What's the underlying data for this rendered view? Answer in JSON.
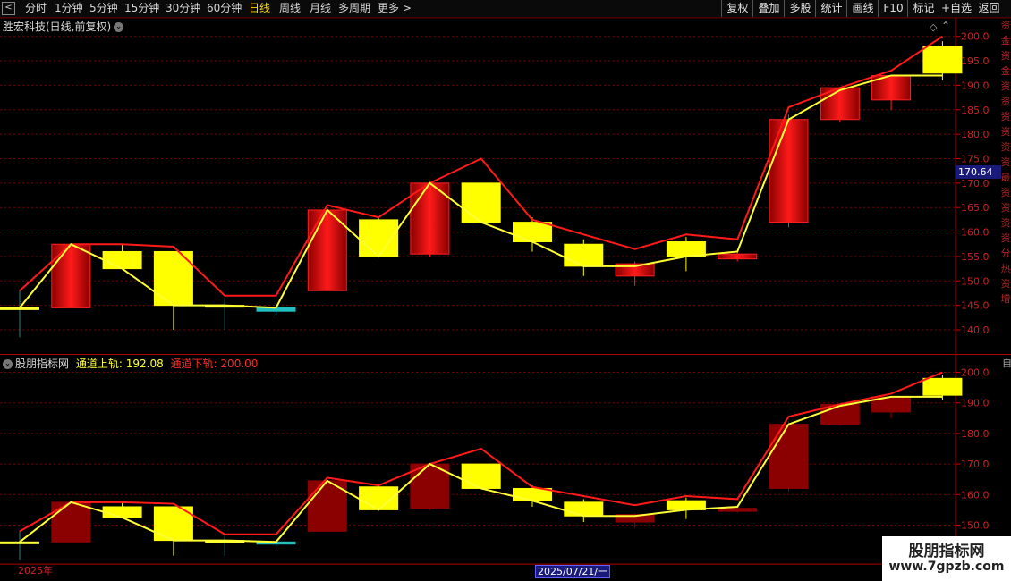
{
  "toolbar": {
    "left_items": [
      {
        "label": "分时",
        "active": false
      },
      {
        "label": "1分钟",
        "active": false
      },
      {
        "label": "5分钟",
        "active": false
      },
      {
        "label": "15分钟",
        "active": false
      },
      {
        "label": "30分钟",
        "active": false
      },
      {
        "label": "60分钟",
        "active": false
      },
      {
        "label": "日线",
        "active": true
      },
      {
        "label": "周线",
        "active": false
      },
      {
        "label": "月线",
        "active": false
      },
      {
        "label": "多周期",
        "active": false
      },
      {
        "label": "更多",
        "active": false
      }
    ],
    "right_items": [
      "复权",
      "叠加",
      "多股",
      "统计",
      "画线",
      "F10",
      "标记",
      "+自选",
      "返回"
    ],
    "more_arrow": ">"
  },
  "main_panel": {
    "title": "胜宏科技(日线,前复权)",
    "price_tag": "170.64",
    "edge_text": [
      "资",
      "金",
      "资",
      "金",
      "资",
      "资",
      "资",
      "资",
      "资",
      "资",
      "最",
      "资",
      "资",
      "资",
      "资",
      "分",
      "热",
      "资",
      "增"
    ],
    "y_ticks": [
      "200.0",
      "195.0",
      "190.0",
      "185.0",
      "180.0",
      "175.0",
      "170.0",
      "165.0",
      "160.0",
      "155.0",
      "150.0",
      "145.0",
      "140.0"
    ]
  },
  "indicator_panel": {
    "title": "股朋指标网",
    "upper_label": "通道上轨:",
    "upper_value": "192.08",
    "lower_label": "通道下轨:",
    "lower_value": "200.00",
    "edge_text": "自",
    "y_ticks": [
      "200.0",
      "190.0",
      "180.0",
      "170.0",
      "160.0",
      "150.0"
    ]
  },
  "date_bar": {
    "left": "2025年",
    "cursor": "2025/07/21/一"
  },
  "watermark": {
    "line1": "股朋指标网",
    "line2": "www.7gpzb.com"
  },
  "colors": {
    "up": "#ff2020",
    "down": "#ffff00",
    "channel_upper": "#ff1a1a",
    "channel_lower": "#ffff33",
    "grid": "#7a0000"
  },
  "chart_data": {
    "type": "candlestick",
    "main_ylim": [
      137,
      202
    ],
    "indicator_ylim": [
      146,
      204
    ],
    "candles": [
      {
        "type": "flat",
        "o": 144.5,
        "c": 144.5,
        "h": 148,
        "l": 138.5
      },
      {
        "type": "up",
        "o": 144.5,
        "c": 157.5,
        "h": 157.5,
        "l": 144.5
      },
      {
        "type": "down",
        "o": 156.0,
        "c": 152.5,
        "h": 157.5,
        "l": 152.5
      },
      {
        "type": "down",
        "o": 156.0,
        "c": 145.0,
        "h": 156.0,
        "l": 140.0
      },
      {
        "type": "flat",
        "o": 145.0,
        "c": 145.0,
        "h": 146.5,
        "l": 140.0
      },
      {
        "type": "cyan",
        "o": 144.5,
        "c": 143.8,
        "h": 145.0,
        "l": 143.0
      },
      {
        "type": "up",
        "o": 148.0,
        "c": 164.5,
        "h": 165.0,
        "l": 148.0
      },
      {
        "type": "down",
        "o": 162.5,
        "c": 155.0,
        "h": 163.0,
        "l": 155.0
      },
      {
        "type": "up",
        "o": 155.5,
        "c": 170.0,
        "h": 170.0,
        "l": 155.0
      },
      {
        "type": "down",
        "o": 170.0,
        "c": 162.0,
        "h": 170.0,
        "l": 162.0
      },
      {
        "type": "down",
        "o": 162.0,
        "c": 158.0,
        "h": 163.0,
        "l": 156.0
      },
      {
        "type": "down",
        "o": 157.5,
        "c": 153.0,
        "h": 158.5,
        "l": 151.0
      },
      {
        "type": "up",
        "o": 151.0,
        "c": 153.5,
        "h": 154.0,
        "l": 149.0
      },
      {
        "type": "down",
        "o": 158.0,
        "c": 155.0,
        "h": 159.0,
        "l": 152.0
      },
      {
        "type": "up",
        "o": 154.5,
        "c": 155.5,
        "h": 156.0,
        "l": 154.0
      },
      {
        "type": "up",
        "o": 162.0,
        "c": 183.0,
        "h": 184.0,
        "l": 161.0
      },
      {
        "type": "up",
        "o": 183.0,
        "c": 189.5,
        "h": 189.5,
        "l": 182.5
      },
      {
        "type": "up",
        "o": 187.0,
        "c": 192.0,
        "h": 192.0,
        "l": 185.0
      },
      {
        "type": "down",
        "o": 198.0,
        "c": 192.5,
        "h": 199.0,
        "l": 191.0
      }
    ],
    "upper_channel": [
      148,
      157.5,
      157.5,
      157,
      147,
      147,
      165.5,
      163,
      170,
      175,
      162.5,
      159.5,
      156.5,
      159.5,
      158.5,
      185.5,
      189.5,
      193,
      200
    ],
    "lower_channel": [
      144.5,
      157.5,
      152.5,
      145,
      145,
      144.5,
      164.5,
      155,
      170,
      162,
      158,
      153,
      153,
      155,
      156,
      183,
      189,
      192,
      192
    ]
  }
}
